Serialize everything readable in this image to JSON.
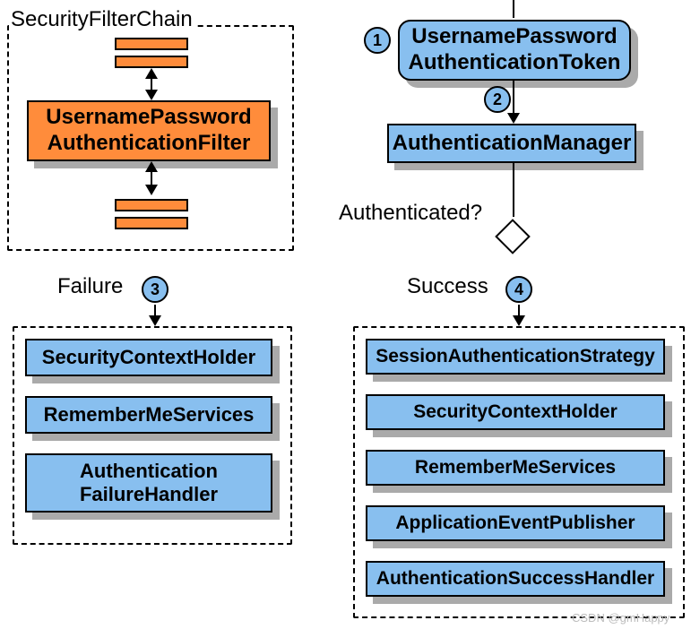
{
  "filterchain": {
    "title": "SecurityFilterChain",
    "main_filter": {
      "line1": "UsernamePassword",
      "line2": "AuthenticationFilter"
    }
  },
  "right_flow": {
    "token": {
      "line1": "UsernamePassword",
      "line2": "AuthenticationToken"
    },
    "manager": "AuthenticationManager",
    "question": "Authenticated?"
  },
  "badges": {
    "b1": "1",
    "b2": "2",
    "b3": "3",
    "b4": "4"
  },
  "failure": {
    "label": "Failure",
    "items": [
      "SecurityContextHolder",
      "RememberMeServices",
      {
        "l1": "Authentication",
        "l2": "FailureHandler"
      }
    ]
  },
  "success": {
    "label": "Success",
    "items": [
      "SessionAuthenticationStrategy",
      "SecurityContextHolder",
      "RememberMeServices",
      "ApplicationEventPublisher",
      "AuthenticationSuccessHandler"
    ]
  },
  "watermark": "CSDN @gmHappy"
}
